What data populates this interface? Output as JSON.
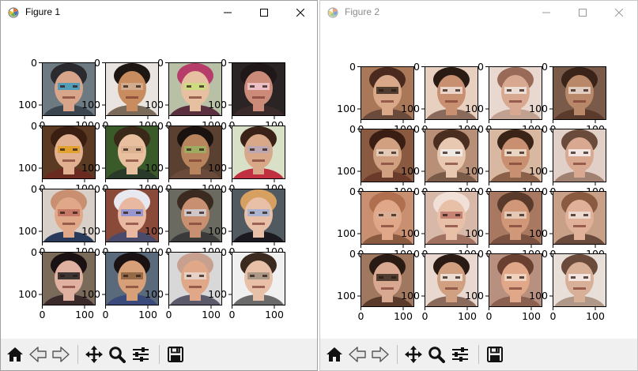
{
  "windows": [
    {
      "id": "win1",
      "title": "Figure 1",
      "active": true,
      "ticks": {
        "y0": "0",
        "y100": "100",
        "x0": "0",
        "x100": "100"
      },
      "tiles": [
        {
          "bg": "#6e7a82",
          "skin": "#d9a58a",
          "hair": "#2b2a2e",
          "shirt": "#3b4550",
          "accent": "#3c9bc0"
        },
        {
          "bg": "#e9e4df",
          "skin": "#c88c5e",
          "hair": "#1e1612",
          "shirt": "#7a6a5a",
          "accent": "#d2b095"
        },
        {
          "bg": "#b8c0a6",
          "skin": "#e6c0a0",
          "hair": "#b63c6a",
          "shirt": "#5a3040",
          "accent": "#c8e07a"
        },
        {
          "bg": "#2a2424",
          "skin": "#cc8a78",
          "hair": "#201818",
          "shirt": "#3a2a2a",
          "accent": "#f0c8d0"
        },
        {
          "bg": "#5a3a22",
          "skin": "#e0b090",
          "hair": "#3a1e12",
          "shirt": "#6a2a20",
          "accent": "#e0a020"
        },
        {
          "bg": "#3a5a2a",
          "skin": "#e8c0a0",
          "hair": "#3a2818",
          "shirt": "#2a3a2a",
          "accent": "#d8b090"
        },
        {
          "bg": "#5a4030",
          "skin": "#b8845e",
          "hair": "#1a120e",
          "shirt": "#6a4a3a",
          "accent": "#98b060"
        },
        {
          "bg": "#d8e0c8",
          "skin": "#d8a888",
          "hair": "#3a2218",
          "shirt": "#c03040",
          "accent": "#b8a8b8"
        },
        {
          "bg": "#d8d0c8",
          "skin": "#e0a888",
          "hair": "#c89070",
          "shirt": "#2a3a5a",
          "accent": "#c07060"
        },
        {
          "bg": "#8a4a3a",
          "skin": "#e8b8a0",
          "hair": "#e8e8f0",
          "shirt": "#4a4a6a",
          "accent": "#8a90d8"
        },
        {
          "bg": "#6a6a60",
          "skin": "#c89070",
          "hair": "#3a2a20",
          "shirt": "#3a3a3a",
          "accent": "#d0d0d8"
        },
        {
          "bg": "#505a60",
          "skin": "#e8c0a8",
          "hair": "#d8a060",
          "shirt": "#1a1a20",
          "accent": "#a0b0d8"
        },
        {
          "bg": "#7a6a5a",
          "skin": "#e0b0a0",
          "hair": "#1a1212",
          "shirt": "#3a2a2a",
          "accent": "#202020"
        },
        {
          "bg": "#5a6a7a",
          "skin": "#d8a078",
          "hair": "#1a1212",
          "shirt": "#3a4a7a",
          "accent": "#8a6040"
        },
        {
          "bg": "#d8d8d8",
          "skin": "#e0a888",
          "hair": "#c8a090",
          "shirt": "#5a5a6a",
          "accent": "#e8d8d0"
        },
        {
          "bg": "#f0f0f0",
          "skin": "#e8c0a8",
          "hair": "#3a2a20",
          "shirt": "#6a6a6a",
          "accent": "#a09080"
        }
      ]
    },
    {
      "id": "win2",
      "title": "Figure 2",
      "active": false,
      "ticks": {
        "y0": "0",
        "y100": "100",
        "x0": "0",
        "x100": "100"
      },
      "tiles": [
        {
          "bg": "#a87858",
          "skin": "#d8a888",
          "hair": "#4a2a1e",
          "shirt": "#6a4a3a",
          "accent": "#3a2a20"
        },
        {
          "bg": "#e8d0c0",
          "skin": "#c89070",
          "hair": "#2a1a14",
          "shirt": "#8a6a5a",
          "accent": "#f0e0d8"
        },
        {
          "bg": "#e8d8d0",
          "skin": "#d8a890",
          "hair": "#9a6a58",
          "shirt": "#c0a090",
          "accent": "#f0e8e0"
        },
        {
          "bg": "#7a5a48",
          "skin": "#b88868",
          "hair": "#3a241a",
          "shirt": "#5a3a2a",
          "accent": "#e8d8d0"
        },
        {
          "bg": "#8a5a40",
          "skin": "#d0a080",
          "hair": "#3a1e14",
          "shirt": "#6a3a2a",
          "accent": "#e8d0c0"
        },
        {
          "bg": "#b89078",
          "skin": "#e8c8b0",
          "hair": "#4a2e20",
          "shirt": "#7a5a48",
          "accent": "#f0f0f0"
        },
        {
          "bg": "#d8b8a0",
          "skin": "#c89070",
          "hair": "#3a2418",
          "shirt": "#8a6048",
          "accent": "#f0e0d0"
        },
        {
          "bg": "#e0d0c8",
          "skin": "#d8a890",
          "hair": "#6a4a3a",
          "shirt": "#a08070",
          "accent": "#f8f0f0"
        },
        {
          "bg": "#c89070",
          "skin": "#e0a888",
          "hair": "#b07050",
          "shirt": "#8a5a40",
          "accent": "#d8b098"
        },
        {
          "bg": "#d8b8a8",
          "skin": "#e8c0a8",
          "hair": "#f0e0d8",
          "shirt": "#a07060",
          "accent": "#c0786a"
        },
        {
          "bg": "#a87860",
          "skin": "#d09878",
          "hair": "#5a3a2a",
          "shirt": "#7a5040",
          "accent": "#e8d0c0"
        },
        {
          "bg": "#c8a088",
          "skin": "#e0b098",
          "hair": "#8a5a40",
          "shirt": "#6a4a3a",
          "accent": "#f0e0d8"
        },
        {
          "bg": "#a07860",
          "skin": "#d8a890",
          "hair": "#2a1a14",
          "shirt": "#5a3a2a",
          "accent": "#3a2a20"
        },
        {
          "bg": "#e8d8d0",
          "skin": "#d0a080",
          "hair": "#2a1a14",
          "shirt": "#8a6a5a",
          "accent": "#f0e8e0"
        },
        {
          "bg": "#b89080",
          "skin": "#e0a888",
          "hair": "#6a4030",
          "shirt": "#8a6050",
          "accent": "#f0d8c8"
        },
        {
          "bg": "#e8e0d8",
          "skin": "#d8b098",
          "hair": "#6a4a3a",
          "shirt": "#b09888",
          "accent": "#f8f0ec"
        }
      ]
    }
  ],
  "toolbar": {
    "icons": [
      "home-icon",
      "back-arrow-icon",
      "forward-arrow-icon",
      "pan-icon",
      "zoom-icon",
      "configure-subplots-icon",
      "save-icon"
    ]
  },
  "window_controls": [
    "minimize-icon",
    "maximize-icon",
    "close-icon"
  ]
}
